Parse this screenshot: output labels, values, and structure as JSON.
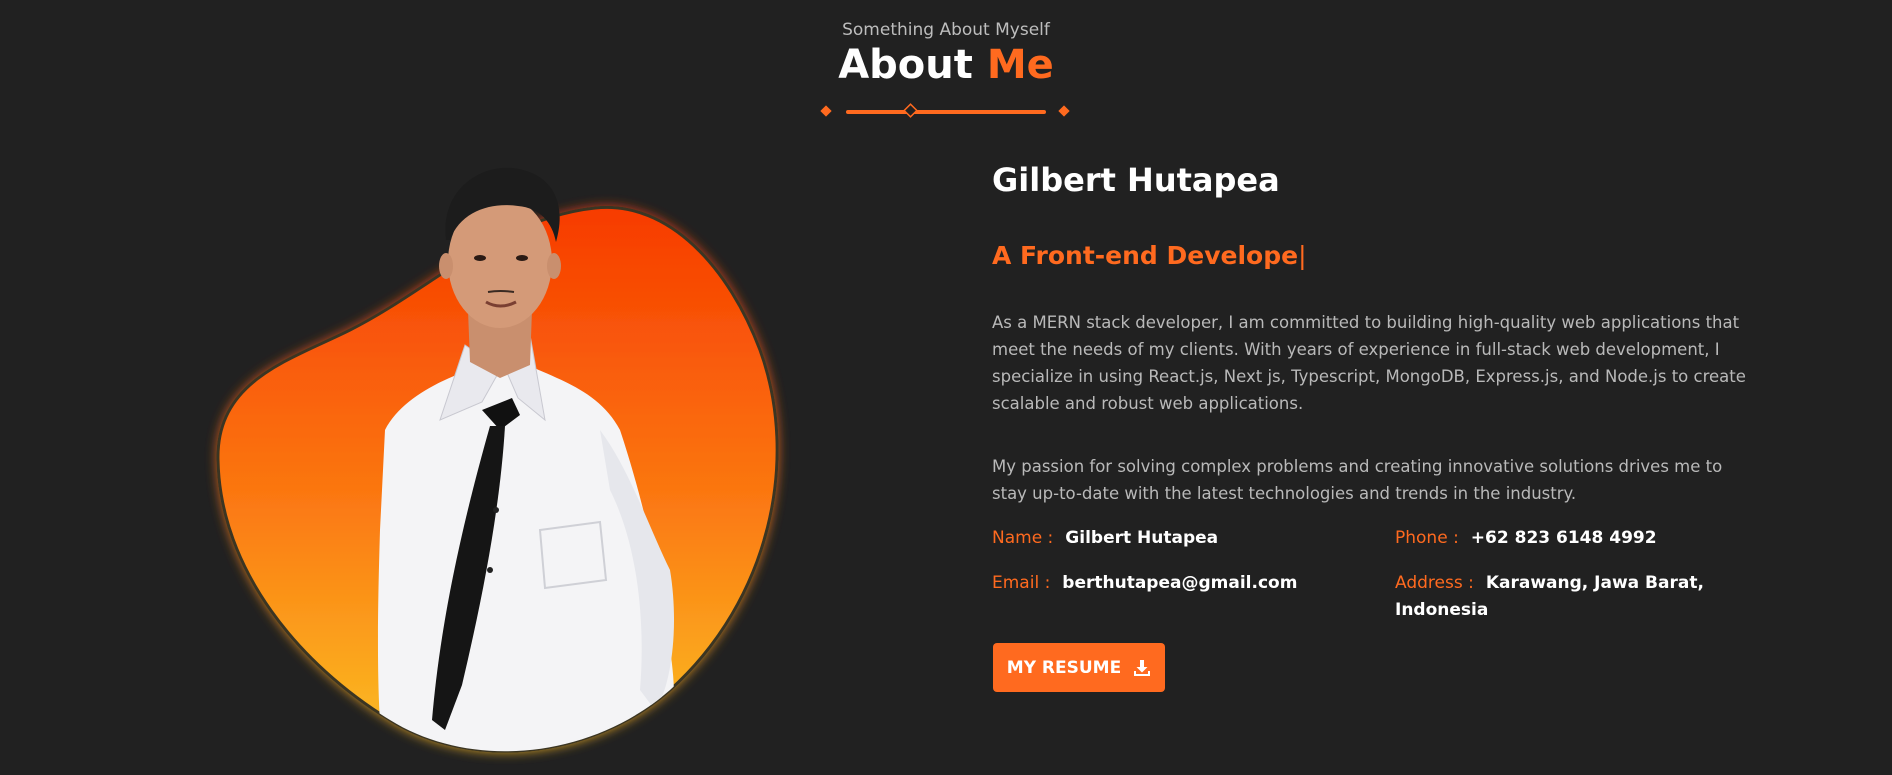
{
  "header": {
    "subheading": "Something About Myself",
    "title_main": "About",
    "title_accent": "Me"
  },
  "profile": {
    "name": "Gilbert Hutapea",
    "role": "A Front-end Develope",
    "caret": "|",
    "bio_1": "As a MERN stack developer, I am committed to building high-quality web applications that meet the needs of my clients. With years of experience in full-stack web development, I specialize in using React.js, Next js, Typescript, MongoDB, Express.js, and Node.js to create scalable and robust web applications.",
    "bio_2": "My passion for solving complex problems and creating innovative solutions drives me to stay up-to-date with the latest technologies and trends in the industry."
  },
  "info": {
    "name_label": "Name :",
    "name_value": "Gilbert Hutapea",
    "phone_label": "Phone :",
    "phone_value": "+62 823 6148 4992",
    "email_label": "Email :",
    "email_value": "berthutapea@gmail.com",
    "address_label": "Address :",
    "address_value": "Karawang, Jawa Barat, Indonesia"
  },
  "actions": {
    "resume_label": "MY RESUME",
    "resume_icon": "download-icon"
  },
  "colors": {
    "background": "#212121",
    "accent": "#ff6a1f",
    "blob_top": "#f73b00",
    "blob_bottom": "#fbbf24",
    "text_muted": "#b9b9b9"
  },
  "icons": {
    "divider": "diamond-divider-icon",
    "portrait": "person-photo"
  }
}
